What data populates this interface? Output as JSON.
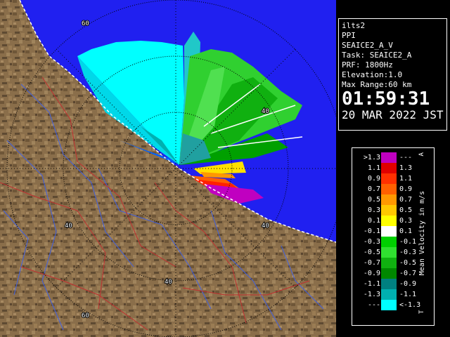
{
  "station": "ilts2",
  "mode": "PPI",
  "product": "SEAICE2_A_V",
  "task": "Task: SEAICE2_A",
  "prf": "PRF: 1800Hz",
  "elevation": "Elevation:1.0",
  "max_range": "Max Range:60 km",
  "time": "01:59:31",
  "date": "20 MAR 2022 JST",
  "range_ring_labels": [
    "60",
    "40",
    "40",
    "40",
    "40",
    "60"
  ],
  "legend": {
    "title": "Mean Velocity in m/s",
    "top_marker": "A",
    "bottom_marker": "T",
    "rows": [
      {
        "lo": ">1.3",
        "hi": "---",
        "color": "#c000c0"
      },
      {
        "lo": "1.1",
        "hi": "1.3",
        "color": "#e00000"
      },
      {
        "lo": "0.9",
        "hi": "1.1",
        "color": "#ff3000"
      },
      {
        "lo": "0.7",
        "hi": "0.9",
        "color": "#ff6000"
      },
      {
        "lo": "0.5",
        "hi": "0.7",
        "color": "#ff9800"
      },
      {
        "lo": "0.3",
        "hi": "0.5",
        "color": "#ffc800"
      },
      {
        "lo": "0.1",
        "hi": "0.3",
        "color": "#ffff00"
      },
      {
        "lo": "-0.1",
        "hi": "0.1",
        "color": "#ffffff"
      },
      {
        "lo": "-0.3",
        "hi": "-0.1",
        "color": "#00d000"
      },
      {
        "lo": "-0.5",
        "hi": "-0.3",
        "color": "#30e030"
      },
      {
        "lo": "-0.7",
        "hi": "-0.5",
        "color": "#10b010"
      },
      {
        "lo": "-0.9",
        "hi": "-0.7",
        "color": "#008800"
      },
      {
        "lo": "-1.1",
        "hi": "-0.9",
        "color": "#008080"
      },
      {
        "lo": "-1.3",
        "hi": "-1.1",
        "color": "#00b0b0"
      },
      {
        "lo": "---",
        "hi": "<-1.3",
        "color": "#00ffff"
      }
    ]
  },
  "colors": {
    "sea": "#2020f0",
    "land": "#8a6e4a",
    "land_dark": "#5e4a32",
    "rivers": "#4060e0",
    "roads": "#c03030"
  }
}
